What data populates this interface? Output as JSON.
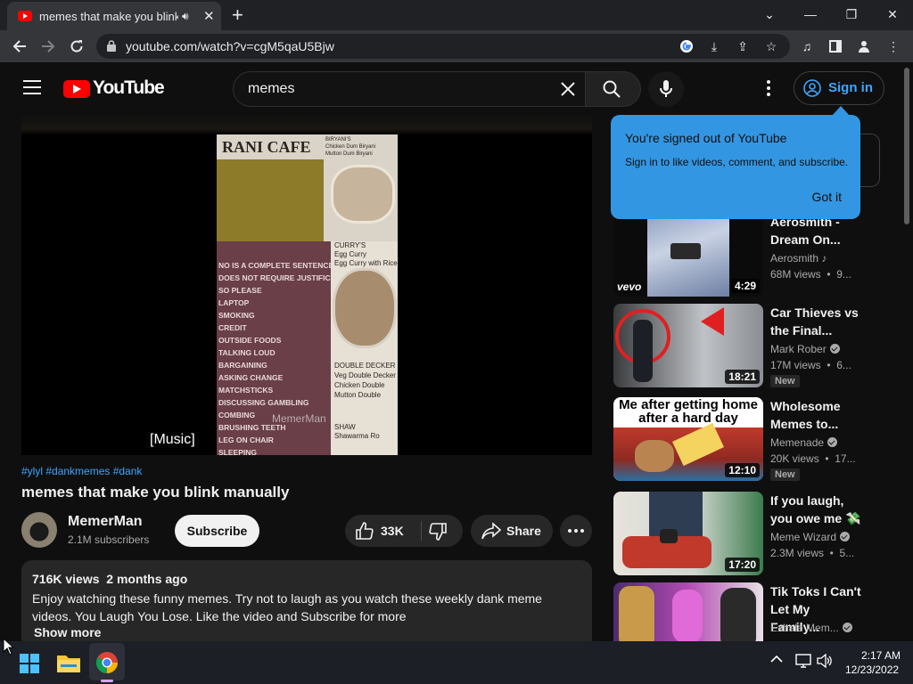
{
  "browser": {
    "tab_title": "memes that make you blink manually",
    "url": "youtube.com/watch?v=cgM5qaU5Bjw"
  },
  "youtube": {
    "logo_text": "YouTube",
    "search_query": "memes",
    "signin_label": "Sign in"
  },
  "popup": {
    "title": "You're signed out of YouTube",
    "body": "Sign in to like videos, comment, and subscribe.",
    "action": "Got it"
  },
  "player": {
    "caption": "[Music]",
    "frame": {
      "menu_title": "RANI CAFE",
      "dish_header": "BIRYANI'S\nChicken Dum Biryani\nMutton Dum Biryani",
      "list_items": "NO IS A COMPLETE SENTENCE\nDOES NOT REQUIRE JUSTIFICATION\nSO PLEASE\nLAPTOP\nSMOKING\nCREDIT\nOUTSIDE FOODS\nTALKING LOUD\nBARGAINING\nASKING CHANGE\nMATCHSTICKS\nDISCUSSING GAMBLING\nCOMBING\nBRUSHING TEETH\nLEG ON CHAIR\nSLEEPING",
      "curry_text": "CURRY'S\nEgg Curry\nEgg Curry with Rice",
      "decker_text": "DOUBLE DECKER\nVeg Double Decker\nChicken Double\nMutton Double",
      "shawarma_text": "SHAW\nShawarma Ro",
      "watermark": "MemerMan"
    }
  },
  "video": {
    "hashtags": "#ylyl #dankmemes #dank",
    "title": "memes that make you blink manually",
    "channel": "MemerMan",
    "subscribers": "2.1M subscribers",
    "subscribe_label": "Subscribe",
    "likes": "33K",
    "share_label": "Share",
    "description": {
      "meta": "716K views  2 months ago",
      "text": "Enjoy watching these funny memes. Try not to laugh as you watch these weekly dank meme videos. You Laugh You Lose. Like the video and Subscribe for more",
      "show_more": "Show more"
    }
  },
  "recommendations": [
    {
      "title": "Aerosmith - Dream On...",
      "channel": "Aerosmith",
      "meta": "68M views  •  9...",
      "duration": "4:29",
      "badge": "",
      "thumb_logo": "vevo"
    },
    {
      "title": "Car Thieves vs the Final...",
      "channel": "Mark Rober",
      "meta": "17M views  •  6...",
      "duration": "18:21",
      "badge": "New"
    },
    {
      "title": "Wholesome Memes to...",
      "channel": "Memenade",
      "meta": "20K views  •  17...",
      "duration": "12:10",
      "badge": "New",
      "thumb_caption": "Me after getting home after a hard day"
    },
    {
      "title": "If you laugh, you owe me 💸",
      "channel": "Meme Wizard",
      "meta": "2.3M views  •  5...",
      "duration": "17:20",
      "badge": ""
    },
    {
      "title": "Tik Toks I Can't Let My Family...",
      "channel": "Exhale Mem...",
      "meta": "",
      "duration": "",
      "badge": ""
    }
  ],
  "taskbar": {
    "time": "2:17 AM",
    "date": "12/23/2022"
  },
  "colors": {
    "accent_blue": "#3ea6ff",
    "youtube_red": "#ff0000",
    "popup_blue": "#3396e3"
  }
}
